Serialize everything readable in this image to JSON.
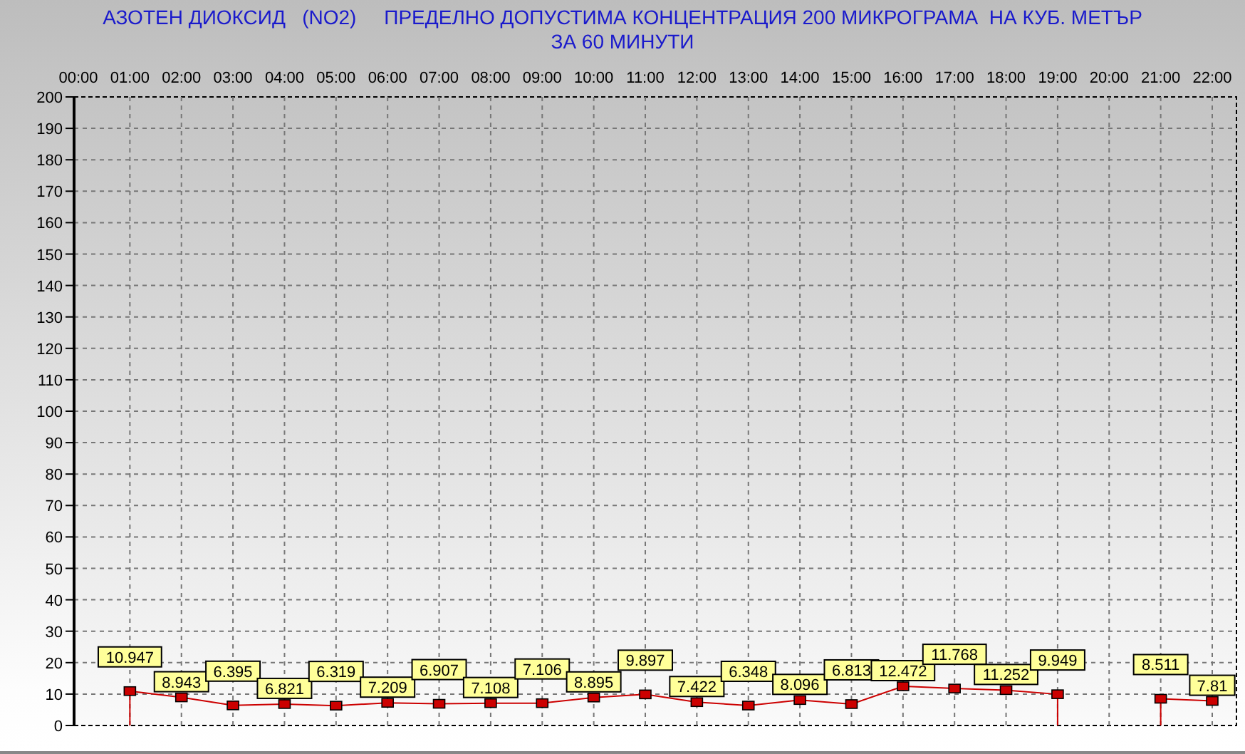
{
  "title": {
    "line_1": "АЗОТЕН ДИОКСИД   (NO2)     ПРЕДЕЛНО ДОПУСТИМА КОНЦЕНТРАЦИЯ 200 МИКРОГРАМА  НА КУБ. МЕТЪР",
    "line_2": "ЗА 60 МИНУТИ"
  },
  "chart": {
    "chart_data": {
      "type": "line",
      "categories": [
        "00:00",
        "01:00",
        "02:00",
        "03:00",
        "04:00",
        "05:00",
        "06:00",
        "07:00",
        "08:00",
        "09:00",
        "10:00",
        "11:00",
        "12:00",
        "13:00",
        "14:00",
        "15:00",
        "16:00",
        "17:00",
        "18:00",
        "19:00",
        "20:00",
        "21:00",
        "22:00"
      ],
      "series": [
        {
          "color": "#cc0000",
          "marker": "square",
          "values": [
            null,
            10.947,
            8.943,
            6.395,
            6.821,
            6.319,
            7.209,
            6.907,
            7.108,
            7.106,
            8.895,
            9.897,
            7.422,
            6.348,
            8.096,
            6.813,
            12.472,
            11.768,
            11.252,
            9.949,
            null,
            8.511,
            7.81
          ]
        }
      ],
      "ylim": [
        0,
        200
      ],
      "yticks": [
        0,
        10,
        20,
        30,
        40,
        50,
        60,
        70,
        80,
        90,
        100,
        110,
        120,
        130,
        140,
        150,
        160,
        170,
        180,
        190,
        200
      ],
      "grid": true,
      "data_labels": true
    }
  }
}
